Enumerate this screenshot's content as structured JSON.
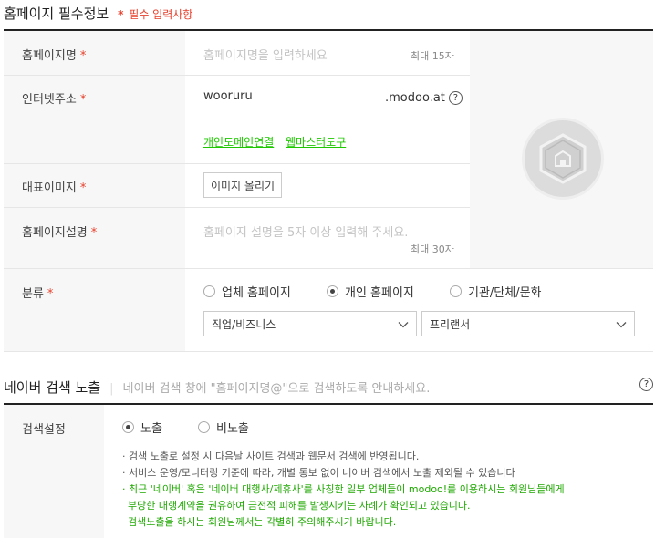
{
  "section1": {
    "title": "홈페이지 필수정보",
    "required_legend_star": "*",
    "required_legend": "필수 입력사항"
  },
  "fields": {
    "name": {
      "label": "홈페이지명",
      "required": "*",
      "placeholder": "홈페이지명을 입력하세요",
      "counter": "최대 15자"
    },
    "domain": {
      "label": "인터넷주소",
      "required": "*",
      "value": "wooruru",
      "suffix": ".modoo.at",
      "help": "?"
    },
    "links": {
      "personal_domain": "개인도메인연결",
      "webmaster": "웹마스터도구"
    },
    "image": {
      "label": "대표이미지",
      "required": "*",
      "button": "이미지 올리기"
    },
    "description": {
      "label": "홈페이지설명",
      "required": "*",
      "placeholder": "홈페이지 설명을 5자 이상 입력해 주세요.",
      "counter": "최대 30자"
    },
    "category": {
      "label": "분류",
      "required": "*",
      "options": [
        "업체 홈페이지",
        "개인 홈페이지",
        "기관/단체/문화"
      ],
      "selected_index": 1,
      "select1": "직업/비즈니스",
      "select2": "프리랜서"
    }
  },
  "section2": {
    "title": "네이버 검색 노출",
    "separator": "|",
    "description": "네이버 검색 창에 \"홈페이지명@\"으로 검색하도록 안내하세요.",
    "help": "?"
  },
  "search": {
    "label": "검색설정",
    "options": [
      "노출",
      "비노출"
    ],
    "selected_index": 0,
    "notes": [
      "· 검색 노출로 설정 시 다음날 사이트 검색과 웹문서 검색에 반영됩니다.",
      "· 서비스 운영/모니터링 기준에 따라, 개별 통보 없이 네이버 검색에서 노출 제외될 수 있습니다"
    ],
    "warning": [
      "· 최근 '네이버' 혹은 '네이버 대행사/제휴사'를 사칭한 일부 업체들이 modoo!를 이용하시는 회원님들에게",
      "  부당한 대행계약을 권유하여 금전적 피해를 발생시키는 사례가 확인되고 있습니다.",
      "  검색노출을 하시는 회원님께서는 각별히 주의해주시기 바랍니다."
    ]
  },
  "colors": {
    "required": "#e8402c",
    "link": "#1ec800",
    "label_bg": "#f7f7f7"
  }
}
